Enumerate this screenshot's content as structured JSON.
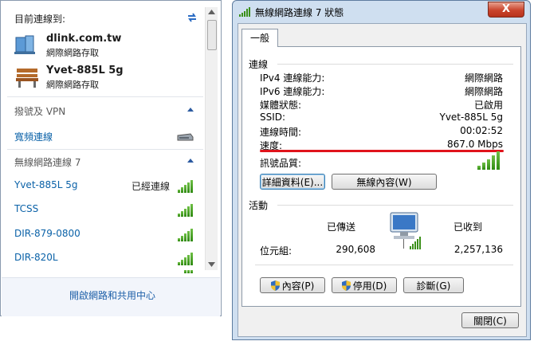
{
  "flyout": {
    "currently_connected": "目前連線到:",
    "connections": [
      {
        "name": "dlink.com.tw",
        "status": "網際網路存取"
      },
      {
        "name": "Yvet-885L 5g",
        "status": "網際網路存取"
      }
    ],
    "dialup_section": "撥號及 VPN",
    "broadband": "寬頻連線",
    "wireless_section": "無線網路連線 7",
    "networks": [
      {
        "name": "Yvet-885L 5g",
        "state": "已經連線"
      },
      {
        "name": "TCSS",
        "state": ""
      },
      {
        "name": "DIR-879-0800",
        "state": ""
      },
      {
        "name": "DIR-820L",
        "state": ""
      }
    ],
    "footer_link": "開啟網路和共用中心"
  },
  "dialog": {
    "title": "無線網路連線 7 狀態",
    "close": "X",
    "tab": "一般",
    "connection": {
      "heading": "連線",
      "rows": [
        {
          "label": "IPv4 連線能力:",
          "value": "網際網路"
        },
        {
          "label": "IPv6 連線能力:",
          "value": "網際網路"
        },
        {
          "label": "媒體狀態:",
          "value": "已啟用"
        },
        {
          "label": "SSID:",
          "value": "Yvet-885L 5g"
        },
        {
          "label": "連線時間:",
          "value": "00:02:52"
        },
        {
          "label": "速度:",
          "value": "867.0 Mbps"
        }
      ],
      "signal_quality": "訊號品質:",
      "details_button": "詳細資料(E)...",
      "wireless_props_button": "無線內容(W)"
    },
    "activity": {
      "heading": "活動",
      "sent": "已傳送",
      "received": "已收到",
      "bytes_label": "位元組:",
      "bytes_sent": "290,608",
      "bytes_received": "2,257,136"
    },
    "buttons": {
      "properties": "內容(P)",
      "disable": "停用(D)",
      "diagnose": "診斷(G)",
      "close": "關閉(C)"
    },
    "highlight_color": "#e0141b"
  }
}
